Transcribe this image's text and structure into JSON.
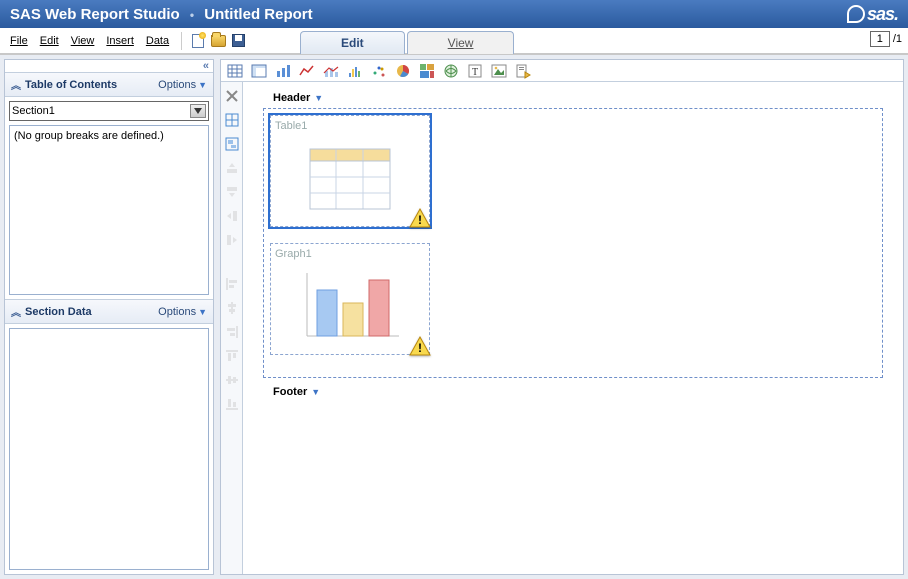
{
  "title": {
    "app": "SAS Web Report Studio",
    "doc": "Untitled Report"
  },
  "logo_text": "sas",
  "menu": {
    "file": "File",
    "edit": "Edit",
    "view": "View",
    "insert": "Insert",
    "data": "Data"
  },
  "page": {
    "current": "1",
    "total": "/1"
  },
  "tabs": {
    "edit": "Edit",
    "view": "View"
  },
  "left": {
    "toc_title": "Table of Contents",
    "options": "Options",
    "section_selected": "Section1",
    "no_groups": "(No group breaks are defined.)",
    "section_data_title": "Section Data"
  },
  "canvas": {
    "header_label": "Header",
    "footer_label": "Footer",
    "objects": [
      {
        "name": "Table1"
      },
      {
        "name": "Graph1"
      }
    ]
  },
  "icons": {
    "collapse": "«"
  }
}
